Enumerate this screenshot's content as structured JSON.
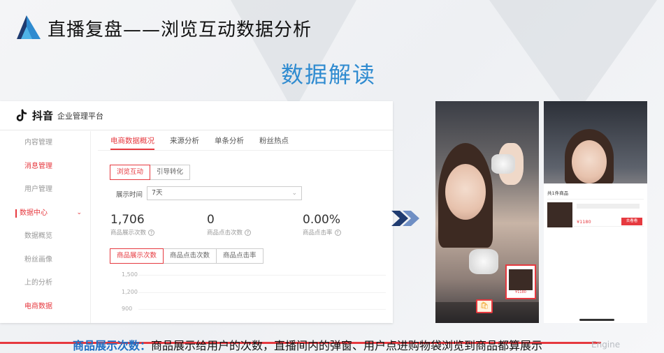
{
  "slide": {
    "title": "直播复盘——浏览互动数据分析",
    "section_title": "数据解读"
  },
  "platform": {
    "brand": "抖音",
    "name": "企业管理平台",
    "sidebar": [
      {
        "label": "内容管理",
        "style": "muted"
      },
      {
        "label": "消息管理",
        "style": "red"
      },
      {
        "label": "用户管理",
        "style": "muted"
      },
      {
        "label": "数据中心",
        "style": "group"
      },
      {
        "label": "数据概览",
        "style": "muted"
      },
      {
        "label": "粉丝画像",
        "style": "muted"
      },
      {
        "label": "上的分析",
        "style": "muted"
      },
      {
        "label": "电商数据",
        "style": "red"
      }
    ],
    "tabs": [
      "电商数据概况",
      "来源分析",
      "单条分析",
      "粉丝热点"
    ],
    "active_tab": 0,
    "sub_tabs": [
      "浏览互动",
      "引导转化"
    ],
    "time_label": "展示时间",
    "time_value": "7天",
    "metrics": [
      {
        "value": "1,706",
        "label": "商品展示次数"
      },
      {
        "value": "0",
        "label": "商品点击次数"
      },
      {
        "value": "0.00%",
        "label": "商品点击率"
      }
    ],
    "metric_tabs": [
      "商品展示次数",
      "商品点击次数",
      "商品点击率"
    ],
    "y_ticks": [
      "1,500",
      "1,200",
      "900"
    ]
  },
  "phones": {
    "small_card_price": "¥1180",
    "panel_title": "共1件商品",
    "panel_price": "¥1180",
    "buy_label": "去看看"
  },
  "caption": {
    "term": "商品展示次数：",
    "text": "商品展示给用户的次数，直播间内的弹窗、用户点进购物袋浏览到商品都算展示"
  },
  "watermark": "Engine",
  "colors": {
    "accent_red": "#e6393f",
    "title_blue": "#2f8bd0",
    "caption_blue": "#1f6fc4"
  },
  "icons": {
    "logo": "book-logo-icon",
    "brand": "tiktok-icon",
    "arrows": "double-chevron-right-icon",
    "bag": "shopping-bag-icon"
  }
}
